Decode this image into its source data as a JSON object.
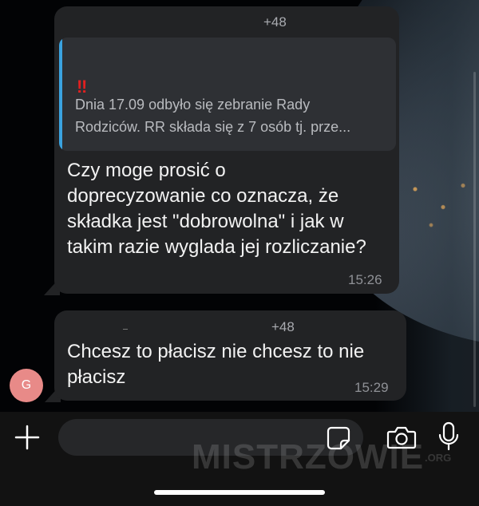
{
  "conversation": {
    "messages": [
      {
        "sender": "+48",
        "quote": {
          "marker": "‼",
          "lines": [
            "Dnia 17.09 odbyło się zebranie Rady",
            "Rodziców. RR składa się z 7 osób tj. prze..."
          ]
        },
        "text_lines": [
          "Czy moge prosić o",
          "doprecyzowanie co oznacza, że",
          "składka jest \"dobrowolna\" i jak w",
          "takim razie wyglada jej rozliczanie?"
        ],
        "time": "15:26"
      },
      {
        "sender": "+48",
        "text_lines": [
          "Chcesz to płacisz nie chcesz to nie",
          "płacisz"
        ],
        "time": "15:29",
        "avatar_initial": "G"
      }
    ]
  },
  "input_bar": {
    "icons": [
      "plus-icon",
      "sticker-icon",
      "camera-icon",
      "microphone-icon"
    ]
  },
  "watermark": {
    "text": "MISTRZOWIE",
    "suffix": ".ORG"
  },
  "colors": {
    "bubble": "#222325",
    "quote_bar": "#3aa3e0",
    "avatar": "#e88a88"
  }
}
